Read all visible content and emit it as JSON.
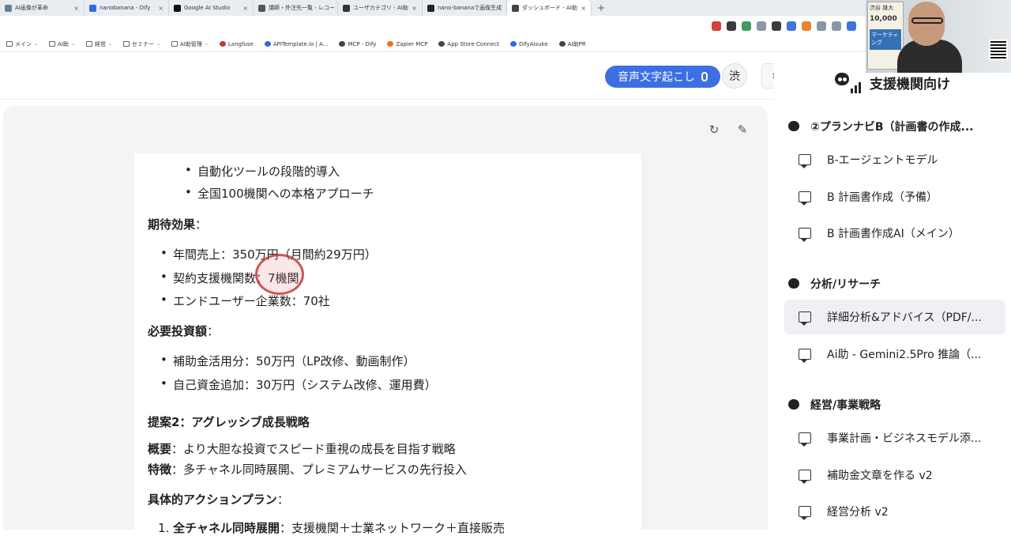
{
  "browser": {
    "tabs": [
      {
        "label": "AI画像が革命",
        "active": false
      },
      {
        "label": "nanobanana - Dify",
        "active": false
      },
      {
        "label": "Google AI Studio",
        "active": false
      },
      {
        "label": "講師・外注先一覧 - レコー",
        "active": false
      },
      {
        "label": "ユーザカテゴリ - AI助",
        "active": false
      },
      {
        "label": "nano-bananaで画像生成",
        "active": false
      },
      {
        "label": "ダッシュボード - AI助",
        "active": true
      }
    ],
    "new_tab_symbol": "+",
    "bookmarks": [
      {
        "label": "メイン",
        "type": "folder"
      },
      {
        "label": "AI助",
        "type": "folder"
      },
      {
        "label": "経営",
        "type": "folder"
      },
      {
        "label": "セミナー",
        "type": "folder"
      },
      {
        "label": "AI助管理",
        "type": "folder"
      },
      {
        "label": "Langfuse",
        "type": "site"
      },
      {
        "label": "APITemplate.io | A...",
        "type": "site"
      },
      {
        "label": "MCP - Dify",
        "type": "site"
      },
      {
        "label": "Zapier MCP",
        "type": "site"
      },
      {
        "label": "App Store Connect",
        "type": "site"
      },
      {
        "label": "DifyAisuke",
        "type": "site"
      },
      {
        "label": "AI助PR",
        "type": "site"
      }
    ]
  },
  "header": {
    "voice_button": "音声文字起こし",
    "avatar_char": "渋",
    "expand_symbol": "›"
  },
  "document": {
    "line1": "自動化ツールの段階的導入",
    "line2": "全国100機関への本格アプローチ",
    "effects_title": "期待効果",
    "colon": "：",
    "effect1": "年間売上：350万円（月間約29万円）",
    "effect2": "契約支援機関数：7機関",
    "effect3": "エンドユーザー企業数：70社",
    "invest_title": "必要投資額",
    "invest1": "補助金活用分：50万円（LP改修、動画制作）",
    "invest2": "自己資金追加：30万円（システム改修、運用費）",
    "proposal_title": "提案2：アグレッシブ成長戦略",
    "overview_label": "概要",
    "overview_text": "：より大胆な投資でスピード重視の成長を目指す戦略",
    "feature_label": "特徴",
    "feature_text": "：多チャネル同時展開、プレミアムサービスの先行投入",
    "action_title": "具体的アクションプラン",
    "action1_num": "1.",
    "action1_label": "全チャネル同時展開",
    "action1_text": "：支援機関＋士業ネットワーク＋直接販売"
  },
  "sidebar": {
    "title": "支援機関向け",
    "sections": [
      {
        "title": "②プランナビB（計画書の作成...",
        "items": [
          "B-エージェントモデル",
          "B 計画書作成（予備）",
          "B 計画書作成AI（メイン）"
        ]
      },
      {
        "title": "分析/リサーチ",
        "items": [
          "詳細分析&アドバイス（PDF/...",
          "Ai助 - Gemini2.5Pro 推論（..."
        ]
      },
      {
        "title": "経営/事業戦略",
        "items": [
          "事業計画・ビジネスモデル添...",
          "補助金文章を作る v2",
          "経営分析 v2"
        ]
      }
    ],
    "selected_item": "詳細分析&アドバイス（PDF/..."
  },
  "webcam": {
    "book_author": "渋谷 雄大",
    "book_number": "10,000",
    "book_tag": "マーケティング"
  }
}
